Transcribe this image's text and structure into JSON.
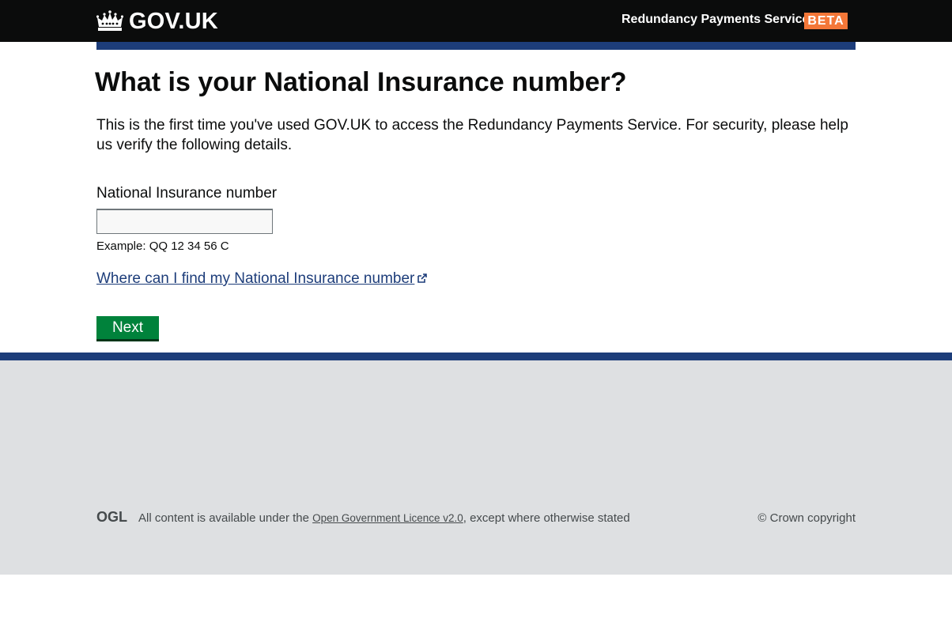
{
  "header": {
    "logo_text": "GOV.UK",
    "service_name": "Redundancy Payments Service",
    "phase": "BETA",
    "colors": {
      "background": "#0b0c0c",
      "phase_tag": "#f47738",
      "accent_bar": "#1d3d7a"
    }
  },
  "main": {
    "title": "What is your National Insurance number?",
    "lede": "This is the first time you've used GOV.UK to access the Redundancy Payments Service. For security, please help us verify the following details.",
    "ni_field": {
      "label": "National Insurance number",
      "value": "",
      "hint": "Example: QQ 12 34 56 C"
    },
    "help_link": "Where can I find my National Insurance number",
    "next_button": "Next",
    "colors": {
      "button": "#00823b",
      "link": "#1d3d7a"
    }
  },
  "footer": {
    "ogl_logo": "OGL",
    "licence_prefix": "All content is available under the ",
    "licence_link": "Open Government Licence v2.0",
    "licence_suffix": ", except where otherwise stated",
    "copyright": "© Crown copyright",
    "colors": {
      "background": "#dee0e2",
      "top_border": "#1d3d7a"
    }
  },
  "icons": [
    "crown-icon",
    "external-link-icon",
    "ogl-logo"
  ]
}
